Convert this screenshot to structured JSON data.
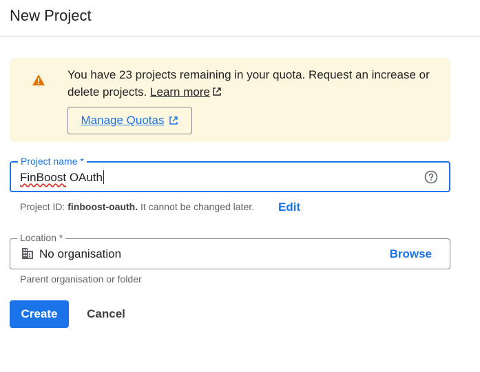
{
  "header": {
    "title": "New Project"
  },
  "banner": {
    "icon": "warning-icon",
    "message": "You have 23 projects remaining in your quota. Request an increase or delete projects.",
    "learn_more": "Learn more",
    "manage_quotas": "Manage Quotas",
    "background": "#fef7e0",
    "icon_color": "#e37400"
  },
  "project_name": {
    "label": "Project name *",
    "value": "FinBoost OAuth",
    "misspelled_part": "FinBoost",
    "rest": " OAuth",
    "help_icon": "help-circle-icon",
    "hint_prefix": "Project ID: ",
    "project_id": "finboost-oauth.",
    "hint_suffix": " It cannot be changed later.",
    "edit": "Edit"
  },
  "location": {
    "label": "Location *",
    "icon": "building-icon",
    "value": "No organisation",
    "browse": "Browse",
    "hint": "Parent organisation or folder"
  },
  "actions": {
    "create": "Create",
    "cancel": "Cancel"
  },
  "colors": {
    "accent": "#1a73e8",
    "text": "#202124",
    "secondary_text": "#5f6368",
    "border": "#80868b",
    "error_squiggle": "#d93025"
  }
}
